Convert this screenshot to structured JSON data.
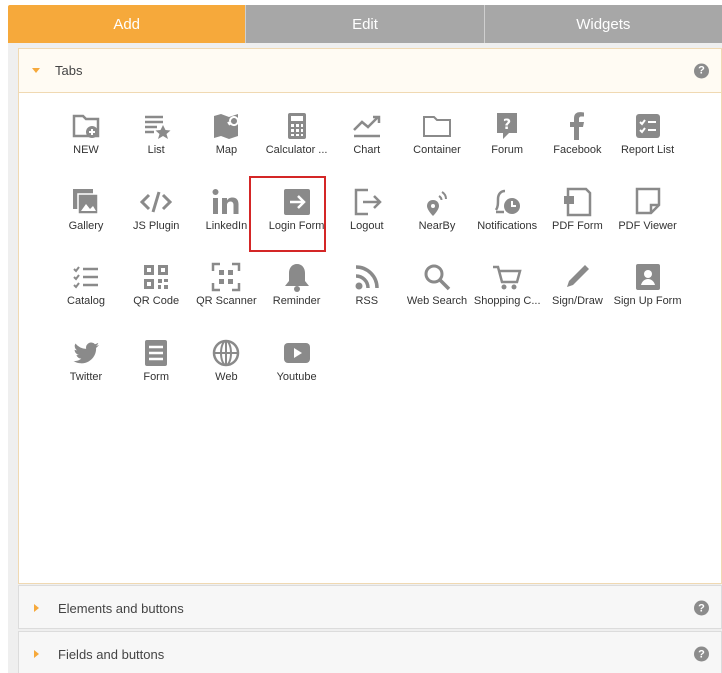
{
  "tabs": [
    {
      "label": "Add"
    },
    {
      "label": "Edit"
    },
    {
      "label": "Widgets"
    }
  ],
  "sections": {
    "tabs": {
      "title": "Tabs",
      "help": "?"
    },
    "elements": {
      "title": "Elements and buttons",
      "help": "?"
    },
    "fields": {
      "title": "Fields and buttons",
      "help": "?"
    }
  },
  "items": [
    {
      "label": "NEW",
      "icon": "new-folder-icon"
    },
    {
      "label": "List",
      "icon": "list-icon"
    },
    {
      "label": "Map",
      "icon": "map-icon"
    },
    {
      "label": "Calculator ...",
      "icon": "calculator-icon"
    },
    {
      "label": "Chart",
      "icon": "chart-icon"
    },
    {
      "label": "Container",
      "icon": "folder-icon"
    },
    {
      "label": "Forum",
      "icon": "forum-icon"
    },
    {
      "label": "Facebook",
      "icon": "facebook-icon"
    },
    {
      "label": "Report List",
      "icon": "report-list-icon"
    },
    {
      "label": "Gallery",
      "icon": "gallery-icon"
    },
    {
      "label": "JS Plugin",
      "icon": "code-icon"
    },
    {
      "label": "LinkedIn",
      "icon": "linkedin-icon"
    },
    {
      "label": "Login Form",
      "icon": "login-icon"
    },
    {
      "label": "Logout",
      "icon": "logout-icon"
    },
    {
      "label": "NearBy",
      "icon": "nearby-icon"
    },
    {
      "label": "Notifications",
      "icon": "notifications-icon"
    },
    {
      "label": "PDF Form",
      "icon": "pdf-form-icon"
    },
    {
      "label": "PDF Viewer",
      "icon": "pdf-viewer-icon"
    },
    {
      "label": "Catalog",
      "icon": "catalog-icon"
    },
    {
      "label": "QR Code",
      "icon": "qr-code-icon"
    },
    {
      "label": "QR Scanner",
      "icon": "qr-scanner-icon"
    },
    {
      "label": "Reminder",
      "icon": "bell-icon"
    },
    {
      "label": "RSS",
      "icon": "rss-icon"
    },
    {
      "label": "Web Search",
      "icon": "search-icon"
    },
    {
      "label": "Shopping C...",
      "icon": "cart-icon"
    },
    {
      "label": "Sign/Draw",
      "icon": "pen-icon"
    },
    {
      "label": "Sign Up Form",
      "icon": "user-card-icon"
    },
    {
      "label": "Twitter",
      "icon": "twitter-icon"
    },
    {
      "label": "Form",
      "icon": "form-icon"
    },
    {
      "label": "Web",
      "icon": "globe-icon"
    },
    {
      "label": "Youtube",
      "icon": "youtube-icon"
    }
  ],
  "selected": "Login Form",
  "colors": {
    "accent": "#f6a93b",
    "tab_inactive": "#a7a7a7",
    "icon": "#8a8a8a",
    "highlight": "#d42626"
  }
}
